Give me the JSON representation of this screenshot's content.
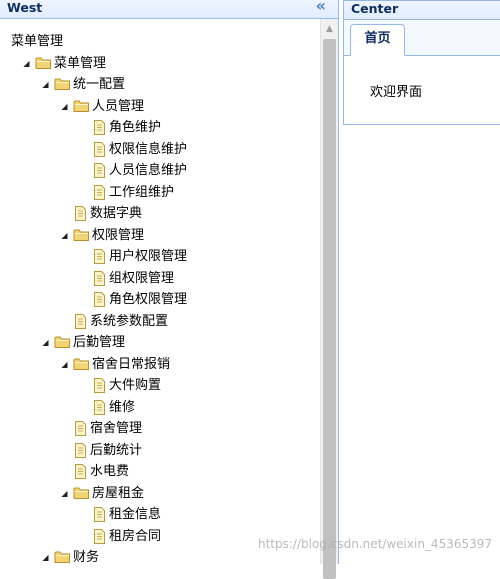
{
  "west": {
    "title": "West",
    "collapse_glyph": "«",
    "tree": [
      {
        "label": "菜单管理",
        "depth": 0,
        "icon": "none",
        "toggle": "none"
      },
      {
        "label": "菜单管理",
        "depth": 1,
        "icon": "folder",
        "toggle": "expanded"
      },
      {
        "label": "统一配置",
        "depth": 2,
        "icon": "folder",
        "toggle": "expanded"
      },
      {
        "label": "人员管理",
        "depth": 3,
        "icon": "folder",
        "toggle": "expanded"
      },
      {
        "label": "角色维护",
        "depth": 4,
        "icon": "file",
        "toggle": "none"
      },
      {
        "label": "权限信息维护",
        "depth": 4,
        "icon": "file",
        "toggle": "none"
      },
      {
        "label": "人员信息维护",
        "depth": 4,
        "icon": "file",
        "toggle": "none"
      },
      {
        "label": "工作组维护",
        "depth": 4,
        "icon": "file",
        "toggle": "none"
      },
      {
        "label": "数据字典",
        "depth": 3,
        "icon": "file",
        "toggle": "none"
      },
      {
        "label": "权限管理",
        "depth": 3,
        "icon": "folder",
        "toggle": "expanded"
      },
      {
        "label": "用户权限管理",
        "depth": 4,
        "icon": "file",
        "toggle": "none"
      },
      {
        "label": "组权限管理",
        "depth": 4,
        "icon": "file",
        "toggle": "none"
      },
      {
        "label": "角色权限管理",
        "depth": 4,
        "icon": "file",
        "toggle": "none"
      },
      {
        "label": "系统参数配置",
        "depth": 3,
        "icon": "file",
        "toggle": "none"
      },
      {
        "label": "后勤管理",
        "depth": 2,
        "icon": "folder",
        "toggle": "expanded"
      },
      {
        "label": "宿舍日常报销",
        "depth": 3,
        "icon": "folder",
        "toggle": "expanded"
      },
      {
        "label": "大件购置",
        "depth": 4,
        "icon": "file",
        "toggle": "none"
      },
      {
        "label": "维修",
        "depth": 4,
        "icon": "file",
        "toggle": "none"
      },
      {
        "label": "宿舍管理",
        "depth": 3,
        "icon": "file",
        "toggle": "none"
      },
      {
        "label": "后勤统计",
        "depth": 3,
        "icon": "file",
        "toggle": "none"
      },
      {
        "label": "水电费",
        "depth": 3,
        "icon": "file",
        "toggle": "none"
      },
      {
        "label": "房屋租金",
        "depth": 3,
        "icon": "folder",
        "toggle": "expanded"
      },
      {
        "label": "租金信息",
        "depth": 4,
        "icon": "file",
        "toggle": "none"
      },
      {
        "label": "租房合同",
        "depth": 4,
        "icon": "file",
        "toggle": "none"
      },
      {
        "label": "财务",
        "depth": 2,
        "icon": "folder",
        "toggle": "expanded"
      }
    ]
  },
  "center": {
    "title": "Center",
    "tabs": [
      {
        "label": "首页"
      }
    ],
    "content": "欢迎界面"
  },
  "watermark": "https://blog.csdn.net/weixin_45365397",
  "colors": {
    "panel_border": "#95b8e7",
    "header_bg": "#e0ecff",
    "header_text": "#0e2d5f",
    "folder_fill": "#f5d97a",
    "file_fill": "#fbf6d6"
  }
}
